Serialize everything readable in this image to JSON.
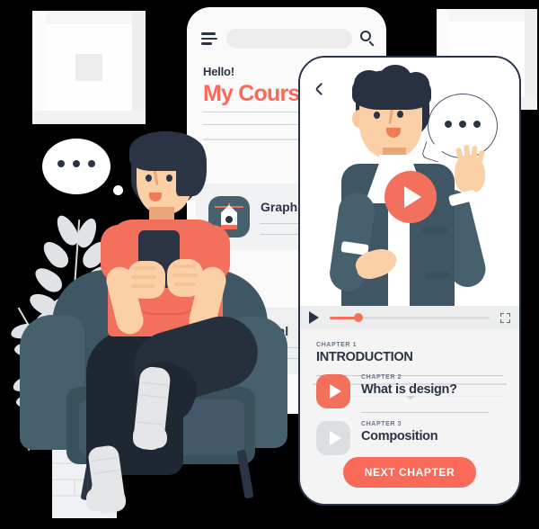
{
  "scene": {
    "title": "Online course mobile app illustration",
    "background_color": "#000000",
    "accent_color": "#f96a58",
    "dark_color": "#2b3445",
    "slate_color": "#46606e"
  },
  "wall": {
    "frames": [
      {
        "name": "picture-frame-left"
      },
      {
        "name": "picture-frame-right"
      }
    ],
    "thought_bubble": {
      "dots": 3
    }
  },
  "plant": {
    "name": "house-plant",
    "leaf_color": "#e0e3e5",
    "pot_color": "#f0f1f2"
  },
  "phone_bg": {
    "menu_icon": "hamburger-menu-icon",
    "search_icon": "search-icon",
    "search_placeholder": "",
    "greeting": "Hello!",
    "heading": "My Courses",
    "courses": [
      {
        "title": "Graphic Design",
        "icon": "pen-tool-icon"
      },
      {
        "title": "Html",
        "icon": "pen-tool-icon"
      }
    ]
  },
  "phone_fg": {
    "back_icon": "back-chevron-icon",
    "video": {
      "play_overlay_icon": "play-icon",
      "speech_bubble_dots": 3,
      "controls": {
        "play_icon": "play-icon",
        "fullscreen_icon": "fullscreen-icon",
        "progress_percent": 18
      }
    },
    "chapters": [
      {
        "label": "CHAPTER 1",
        "title": "INTRODUCTION",
        "state": "current",
        "icon": ""
      },
      {
        "label": "CHAPTER 2",
        "title": "What is design?",
        "state": "active",
        "icon": "play-icon"
      },
      {
        "label": "CHAPTER 3",
        "title": "Composition",
        "state": "locked",
        "icon": "play-icon"
      }
    ],
    "next_button": "NEXT CHAPTER"
  },
  "person": {
    "name": "seated-person-with-phone",
    "shirt_color": "#f2705c",
    "pants_color": "#1f2733",
    "sock_color": "#e4e6e8"
  },
  "chair": {
    "name": "armchair",
    "color": "#46606e"
  }
}
